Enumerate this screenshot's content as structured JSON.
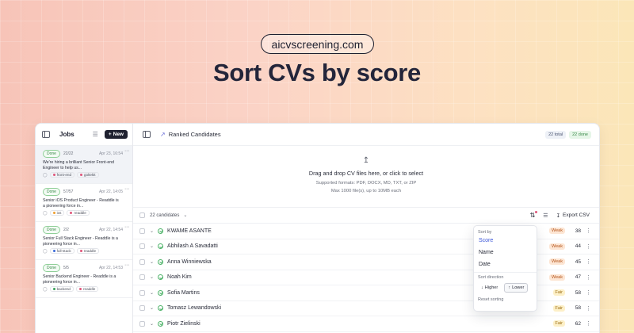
{
  "banner": {
    "site": "aicvscreening.com",
    "headline": "Sort CVs by score"
  },
  "sidebar": {
    "title": "Jobs",
    "new_label": "New",
    "jobs": [
      {
        "status": "Done",
        "count": "22/22",
        "date": "Apr 23, 16:54",
        "desc": "We're hiring a brilliant Senior Front-end Engineer to help us...",
        "tags": [
          {
            "label": "front-end",
            "color": "#e0567a"
          },
          {
            "label": "goltekit",
            "color": "#e0567a"
          }
        ]
      },
      {
        "status": "Done",
        "count": "57/57",
        "date": "Apr 22, 14:05",
        "desc": "Senior iOS Product Engineer - Readdle is a pioneering force in...",
        "tags": [
          {
            "label": "ios",
            "color": "#f0a030"
          },
          {
            "label": "readdle",
            "color": "#e0567a"
          }
        ]
      },
      {
        "status": "Done",
        "count": "2/2",
        "date": "Apr 22, 14:54",
        "desc": "Senior Full Stack Engineer - Readdle is a pioneering force in...",
        "tags": [
          {
            "label": "full-stack",
            "color": "#3a6ad8"
          },
          {
            "label": "readdle",
            "color": "#e0567a"
          }
        ]
      },
      {
        "status": "Done",
        "count": "5/5",
        "date": "Apr 22, 14:53",
        "desc": "Senior Backend Engineer - Readdle is a pioneering force in...",
        "tags": [
          {
            "label": "backend",
            "color": "#3aa05a"
          },
          {
            "label": "readdle",
            "color": "#e0567a"
          }
        ]
      }
    ]
  },
  "topbar": {
    "title": "Ranked Candidates",
    "total": "22 total",
    "done": "22 done"
  },
  "dropzone": {
    "title": "Drag and drop CV files here, or click to select",
    "formats": "Supported formats: PDF, DOCX, MD, TXT, or ZIP",
    "limits": "Max 1000 file(s), up to 10MB each"
  },
  "list": {
    "count_label": "22 candidates",
    "export_label": "Export CSV",
    "candidates": [
      {
        "name": "KWAME ASANTE",
        "rating": "Weak",
        "score": "38"
      },
      {
        "name": "Abhilash A Savadatti",
        "rating": "Weak",
        "score": "44"
      },
      {
        "name": "Anna Winniewska",
        "rating": "Weak",
        "score": "45"
      },
      {
        "name": "Noah Kim",
        "rating": "Weak",
        "score": "47"
      },
      {
        "name": "Sofia Martins",
        "rating": "Fair",
        "score": "58"
      },
      {
        "name": "Tomasz Lewandowski",
        "rating": "Fair",
        "score": "58"
      },
      {
        "name": "Piotr Zielinski",
        "rating": "Fair",
        "score": "62"
      }
    ]
  },
  "sort_menu": {
    "sort_by_label": "Sort by",
    "options": [
      "Score",
      "Name",
      "Date"
    ],
    "selected": "Score",
    "direction_label": "Sort direction",
    "higher": "Higher",
    "lower": "Lower",
    "active_direction": "Lower",
    "reset": "Reset sorting"
  },
  "colors": {
    "accent": "#3a55d8",
    "done_green": "#3b8a4a",
    "weak": "#b4541a",
    "fair": "#9a6b12"
  }
}
